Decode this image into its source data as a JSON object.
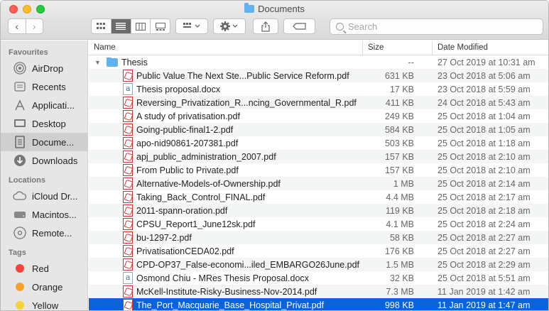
{
  "window": {
    "title": "Documents"
  },
  "toolbar": {
    "back_label": "‹",
    "forward_label": "›",
    "search_placeholder": "Search"
  },
  "sidebar": {
    "favourites_header": "Favourites",
    "favourites": [
      {
        "label": "AirDrop",
        "icon": "airdrop-icon"
      },
      {
        "label": "Recents",
        "icon": "clock-icon"
      },
      {
        "label": "Applicati...",
        "icon": "applications-icon"
      },
      {
        "label": "Desktop",
        "icon": "desktop-icon"
      },
      {
        "label": "Docume...",
        "icon": "document-icon"
      },
      {
        "label": "Downloads",
        "icon": "download-icon"
      }
    ],
    "locations_header": "Locations",
    "locations": [
      {
        "label": "iCloud Dr...",
        "icon": "cloud-icon"
      },
      {
        "label": "Macintos...",
        "icon": "disk-icon"
      },
      {
        "label": "Remote...",
        "icon": "remote-disc-icon"
      }
    ],
    "tags_header": "Tags",
    "tags": [
      {
        "label": "Red",
        "color": "#f4433d"
      },
      {
        "label": "Orange",
        "color": "#f7a12d"
      },
      {
        "label": "Yellow",
        "color": "#f5d33b"
      }
    ]
  },
  "columns": {
    "name": "Name",
    "size": "Size",
    "date": "Date Modified"
  },
  "folder": {
    "name": "Thesis",
    "size": "--",
    "date": "27 Oct 2019 at 10:31 am"
  },
  "files": [
    {
      "name": "Public Value The Next Ste...Public Service Reform.pdf",
      "size": "631 KB",
      "date": "23 Oct 2018 at 5:06 am",
      "type": "pdf"
    },
    {
      "name": "Thesis proposal.docx",
      "size": "17 KB",
      "date": "23 Oct 2018 at 5:59 am",
      "type": "doc"
    },
    {
      "name": "Reversing_Privatization_R...ncing_Governmental_R.pdf",
      "size": "411 KB",
      "date": "24 Oct 2018 at 5:43 am",
      "type": "pdf"
    },
    {
      "name": "A study of privatisation.pdf",
      "size": "249 KB",
      "date": "25 Oct 2018 at 1:04 am",
      "type": "pdf"
    },
    {
      "name": "Going-public-final1-2.pdf",
      "size": "584 KB",
      "date": "25 Oct 2018 at 1:05 am",
      "type": "pdf"
    },
    {
      "name": "apo-nid90861-207381.pdf",
      "size": "503 KB",
      "date": "25 Oct 2018 at 1:18 am",
      "type": "pdf"
    },
    {
      "name": "apj_public_administration_2007.pdf",
      "size": "157 KB",
      "date": "25 Oct 2018 at 2:10 am",
      "type": "pdf"
    },
    {
      "name": "From Public to Private.pdf",
      "size": "157 KB",
      "date": "25 Oct 2018 at 2:10 am",
      "type": "pdf"
    },
    {
      "name": "Alternative-Models-of-Ownership.pdf",
      "size": "1 MB",
      "date": "25 Oct 2018 at 2:14 am",
      "type": "pdf"
    },
    {
      "name": "Taking_Back_Control_FINAL.pdf",
      "size": "4.4 MB",
      "date": "25 Oct 2018 at 2:17 am",
      "type": "pdf"
    },
    {
      "name": "2011-spann-oration.pdf",
      "size": "119 KB",
      "date": "25 Oct 2018 at 2:18 am",
      "type": "pdf"
    },
    {
      "name": "CPSU_Report1_June12sk.pdf",
      "size": "4.1 MB",
      "date": "25 Oct 2018 at 2:24 am",
      "type": "pdf"
    },
    {
      "name": "bu-1297-2.pdf",
      "size": "58 KB",
      "date": "25 Oct 2018 at 2:27 am",
      "type": "pdf"
    },
    {
      "name": "PrivatisationCEDA02.pdf",
      "size": "176 KB",
      "date": "25 Oct 2018 at 2:27 am",
      "type": "pdf"
    },
    {
      "name": "CPD-OP37_False-economi...iled_EMBARGO26June.pdf",
      "size": "1.5 MB",
      "date": "25 Oct 2018 at 2:29 am",
      "type": "pdf"
    },
    {
      "name": "Osmond Chiu - MRes Thesis Proposal.docx",
      "size": "32 KB",
      "date": "25 Oct 2018 at 5:51 am",
      "type": "doc"
    },
    {
      "name": "McKell-Institute-Risky-Business-Nov-2014.pdf",
      "size": "7.3 MB",
      "date": "11 Jan 2019 at 1:42 am",
      "type": "pdf"
    },
    {
      "name": "The_Port_Macquarie_Base_Hospital_Privat.pdf",
      "size": "998 KB",
      "date": "11 Jan 2019 at 1:47 am",
      "type": "pdf",
      "selected": true
    }
  ]
}
